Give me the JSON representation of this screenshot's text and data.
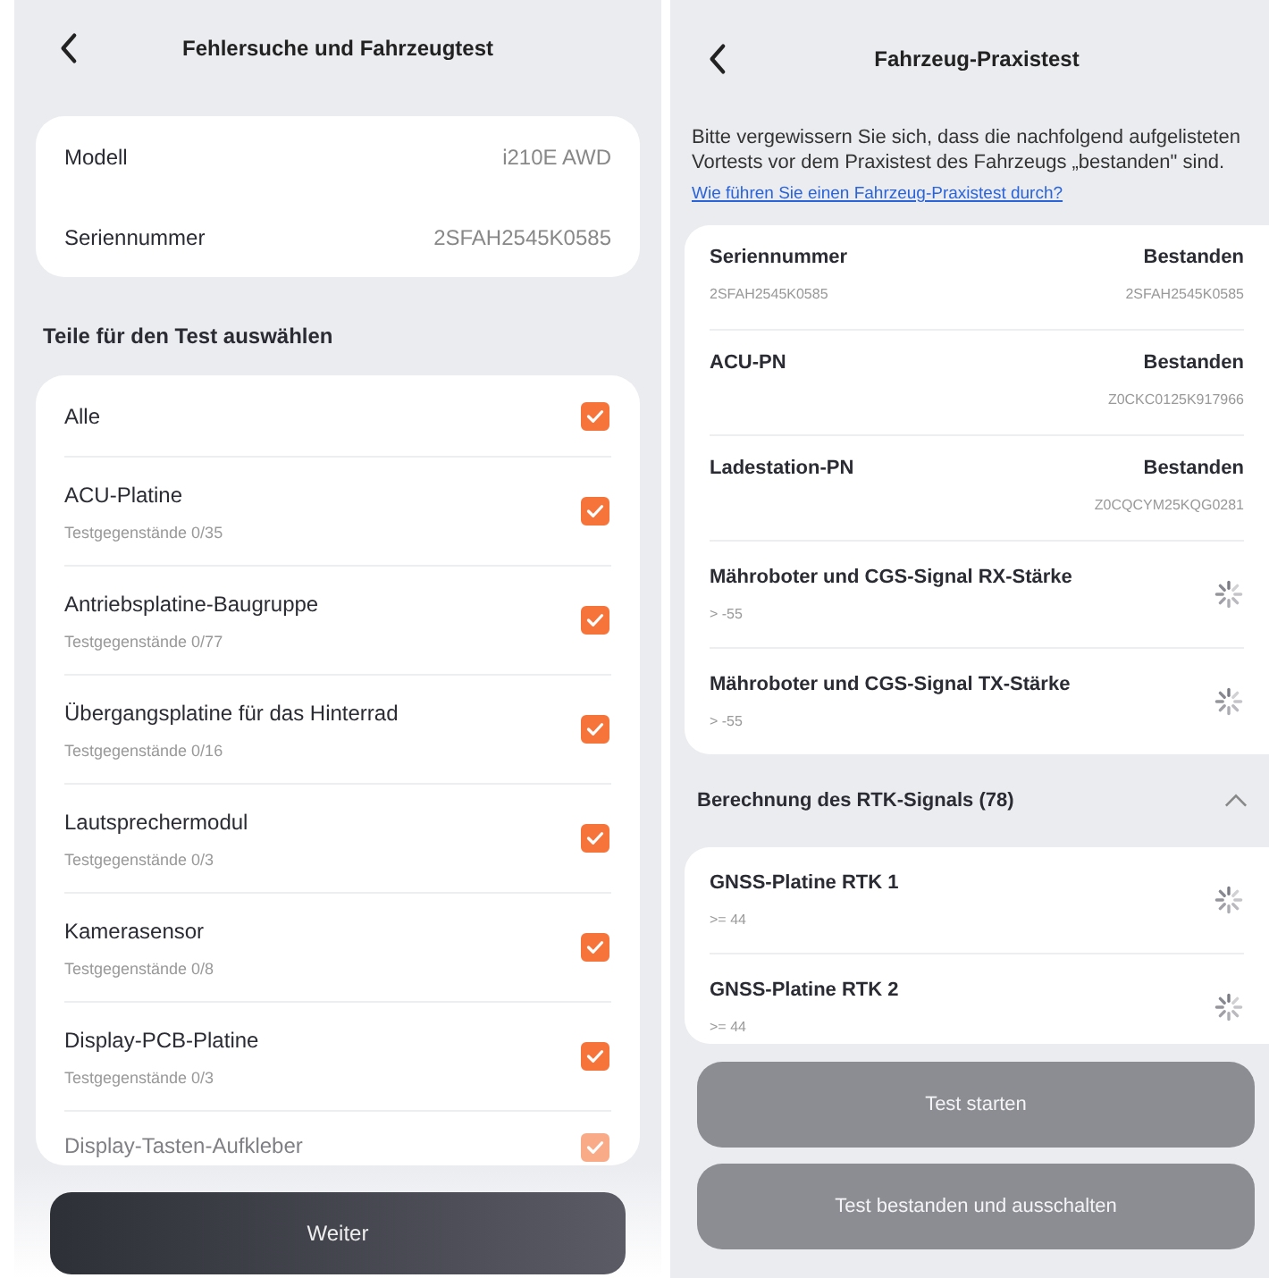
{
  "left_screen": {
    "title": "Fehlersuche und Fahrzeugtest",
    "info": [
      {
        "label": "Modell",
        "value": "i210E AWD"
      },
      {
        "label": "Seriennummer",
        "value": "2SFAH2545K0585"
      }
    ],
    "section_title": "Teile für den Test auswählen",
    "parts": [
      {
        "name": "Alle",
        "checked": true
      },
      {
        "name": "ACU-Platine",
        "count": "Testgegenstände 0/35",
        "checked": true
      },
      {
        "name": "Antriebsplatine-Baugruppe",
        "count": "Testgegenstände 0/77",
        "checked": true
      },
      {
        "name": "Übergangsplatine für das Hinterrad",
        "count": "Testgegenstände 0/16",
        "checked": true
      },
      {
        "name": "Lautsprechermodul",
        "count": "Testgegenstände 0/3",
        "checked": true
      },
      {
        "name": "Kamerasensor",
        "count": "Testgegenstände 0/8",
        "checked": true
      },
      {
        "name": "Display-PCB-Platine",
        "count": "Testgegenstände 0/3",
        "checked": true
      },
      {
        "name": "Display-Tasten-Aufkleber",
        "checked": true
      }
    ],
    "button": "Weiter"
  },
  "right_screen": {
    "title": "Fahrzeug-Praxistest",
    "intro": "Bitte vergewissern Sie sich, dass die nachfolgend aufgelisteten Vortests vor dem Praxistest des Fahrzeugs „bestanden\" sind.",
    "help_link": "Wie führen Sie einen Fahrzeug-Praxistest durch?",
    "pretests": [
      {
        "kind": "passed",
        "name": "Seriennummer",
        "sub": "2SFAH2545K0585",
        "status": "Bestanden",
        "value": "2SFAH2545K0585"
      },
      {
        "kind": "passed",
        "name": "ACU-PN",
        "status": "Bestanden",
        "value": "Z0CKC0125K917966"
      },
      {
        "kind": "passed",
        "name": "Ladestation-PN",
        "status": "Bestanden",
        "value": "Z0CQCYM25KQG0281"
      },
      {
        "kind": "pending",
        "name": "Mähroboter und CGS-Signal RX-Stärke",
        "sub": "> -55"
      },
      {
        "kind": "pending",
        "name": "Mähroboter und CGS-Signal TX-Stärke",
        "sub": "> -55"
      }
    ],
    "rtk_section": {
      "title": "Berechnung des RTK-Signals (78)",
      "expanded": true,
      "items": [
        {
          "kind": "pending",
          "name": "GNSS-Platine RTK 1",
          "sub": ">= 44"
        },
        {
          "kind": "pending",
          "name": "GNSS-Platine RTK 2",
          "sub": ">= 44"
        }
      ]
    },
    "buttons": [
      "Test starten",
      "Test bestanden und ausschalten"
    ]
  }
}
